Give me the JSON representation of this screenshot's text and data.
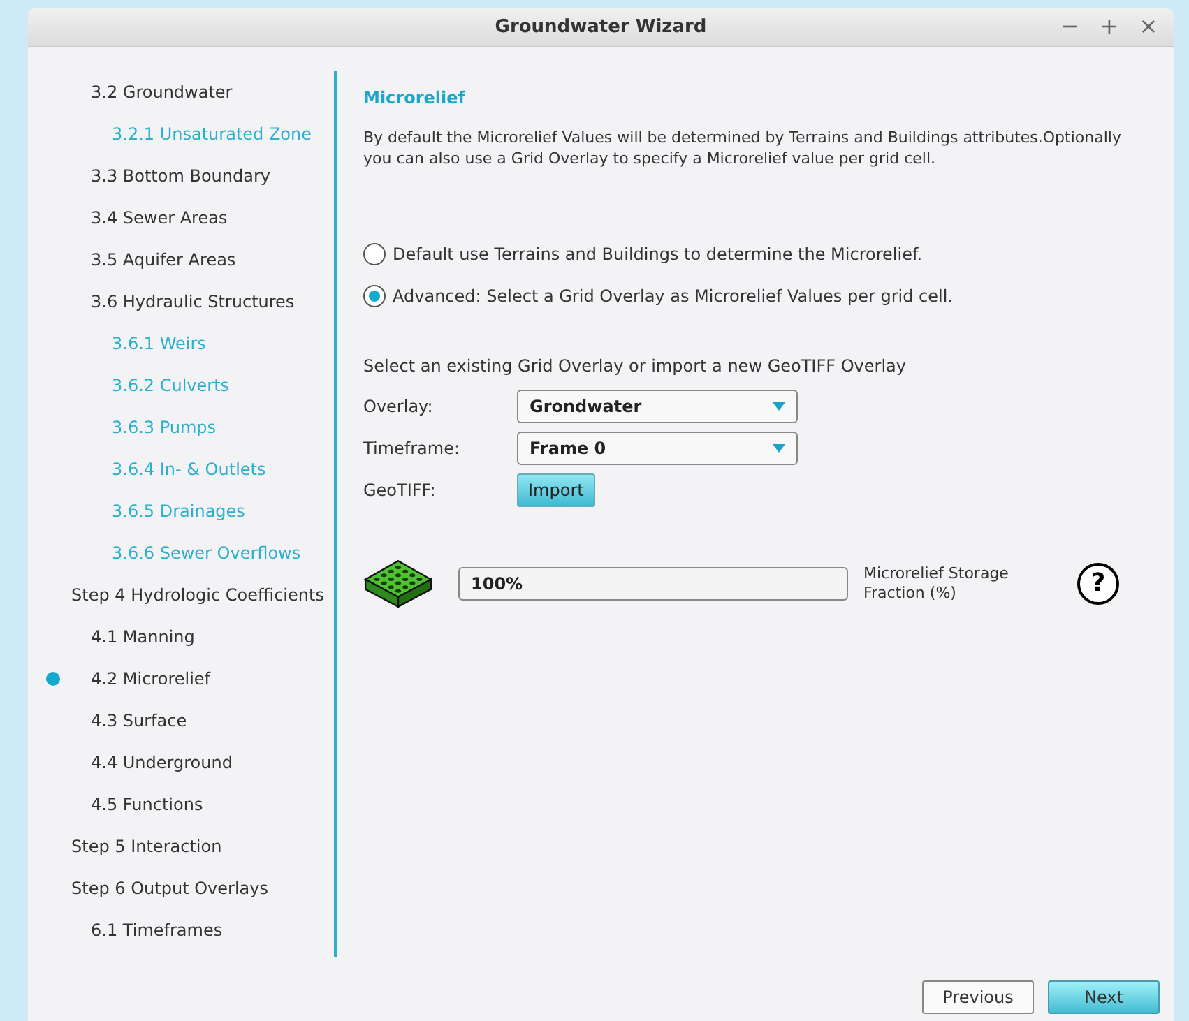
{
  "window": {
    "title": "Groundwater Wizard",
    "controls": [
      "−",
      "+",
      "×"
    ]
  },
  "sidebar": {
    "items": [
      {
        "children": [
          {
            "label": "3.2 Groundwater",
            "selected": false,
            "children": [
              {
                "label": "3.2.1 Unsaturated Zone",
                "selected": false
              }
            ]
          },
          {
            "label": "3.3 Bottom Boundary",
            "selected": false
          },
          {
            "label": "3.4 Sewer Areas",
            "selected": false
          },
          {
            "label": "3.5 Aquifer Areas",
            "selected": false
          },
          {
            "label": "3.6 Hydraulic Structures",
            "selected": false,
            "children": [
              {
                "label": "3.6.1 Weirs",
                "selected": false
              },
              {
                "label": "3.6.2 Culverts",
                "selected": false
              },
              {
                "label": "3.6.3 Pumps",
                "selected": false
              },
              {
                "label": "3.6.4 In- & Outlets",
                "selected": false
              },
              {
                "label": "3.6.5 Drainages",
                "selected": false
              },
              {
                "label": "3.6.6 Sewer Overflows",
                "selected": false
              }
            ]
          }
        ]
      },
      {
        "label": "Step 4 Hydrologic Coefficients",
        "selected": false,
        "children": [
          {
            "label": "4.1 Manning",
            "selected": false
          },
          {
            "label": "4.2 Microrelief",
            "selected": true
          },
          {
            "label": "4.3 Surface",
            "selected": false
          },
          {
            "label": "4.4 Underground",
            "selected": false
          },
          {
            "label": "4.5 Functions",
            "selected": false
          }
        ]
      },
      {
        "label": "Step 5 Interaction",
        "selected": false
      },
      {
        "label": "Step 6 Output Overlays",
        "selected": false,
        "children": [
          {
            "label": "6.1 Timeframes",
            "selected": false
          }
        ]
      }
    ]
  },
  "content": {
    "title": "Microrelief",
    "description": "By default the Microrelief Values will be determined by Terrains and Buildings attributes.Optionally you can also use a Grid Overlay to specify a Microrelief value per grid cell.",
    "options": [
      {
        "label": "Default use Terrains and Buildings to determine the Microrelief.",
        "selected": false
      },
      {
        "label": "Advanced: Select a Grid Overlay as Microrelief Values per grid cell.",
        "selected": true
      }
    ],
    "instruction": "Select an existing Grid Overlay or import a new GeoTIFF Overlay",
    "fields": [
      {
        "kind": "dropdown",
        "label": "Overlay:",
        "value": "Grondwater"
      },
      {
        "kind": "dropdown",
        "label": "Timeframe:",
        "value": "Frame 0"
      },
      {
        "kind": "button",
        "label": "GeoTIFF:",
        "value": "Import"
      }
    ],
    "storage": {
      "value": "100%",
      "label": "Microrelief Storage Fraction (%)",
      "help": "?"
    }
  },
  "footer": {
    "buttons": [
      {
        "label": "Previous",
        "primary": false
      },
      {
        "label": "Next",
        "primary": true
      }
    ]
  }
}
